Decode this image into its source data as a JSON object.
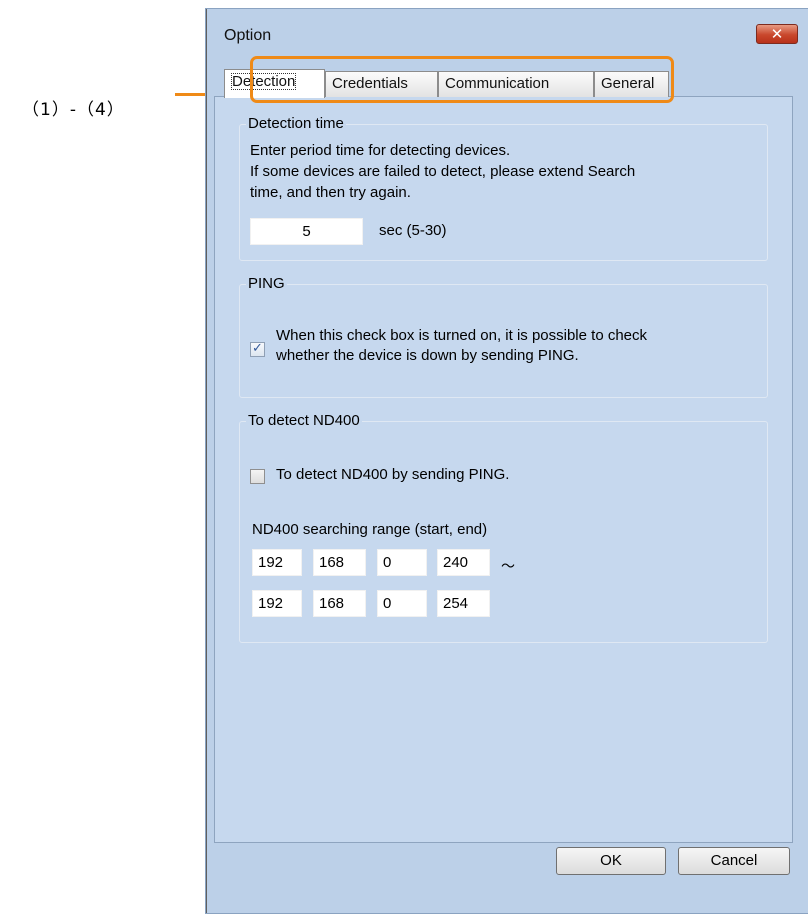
{
  "annotation": {
    "label": "（1）-（4）",
    "color": "#ef8a17"
  },
  "window": {
    "title": "Option",
    "close_icon": "close-icon",
    "background": "#bcd0e8"
  },
  "tabs": [
    {
      "label": "Detection",
      "active": true
    },
    {
      "label": "Credentials",
      "active": false
    },
    {
      "label": "Communication",
      "active": false
    },
    {
      "label": "General",
      "active": false
    }
  ],
  "detection_time": {
    "title": "Detection time",
    "description": [
      "Enter period time for detecting devices.",
      "If some devices are failed to detect, please extend Search",
      "time, and then try again."
    ],
    "value": "5",
    "unit": "sec (5-30)"
  },
  "ping": {
    "title": "PING",
    "checked": true,
    "text": [
      "When this check box is turned on, it is possible to check",
      "whether the device is down by sending PING."
    ]
  },
  "nd400": {
    "title": "To detect ND400",
    "checkbox_label": "To detect ND400 by sending PING.",
    "checked": false,
    "range_label": "ND400 searching range (start, end)",
    "start": [
      "192",
      "168",
      "0",
      "240"
    ],
    "end": [
      "192",
      "168",
      "0",
      "254"
    ],
    "separator": "～"
  },
  "buttons": {
    "ok": "OK",
    "cancel": "Cancel"
  }
}
